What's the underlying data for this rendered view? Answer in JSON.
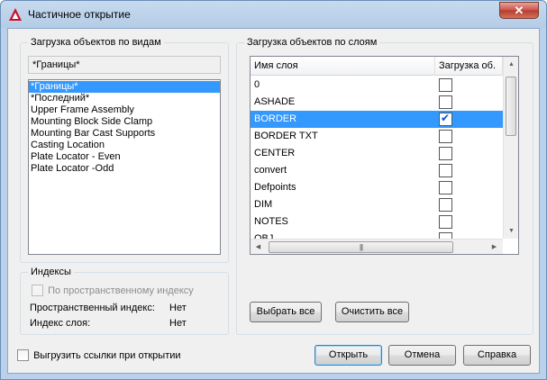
{
  "window": {
    "title": "Частичное открытие",
    "close_glyph": "✕"
  },
  "views_group": {
    "label": "Загрузка объектов по видам",
    "current_view": "*Границы*",
    "items": [
      {
        "label": "*Границы*",
        "selected": true
      },
      {
        "label": "*Последний*",
        "selected": false
      },
      {
        "label": "Upper Frame Assembly",
        "selected": false
      },
      {
        "label": "Mounting Block Side Clamp",
        "selected": false
      },
      {
        "label": "Mounting Bar Cast Supports",
        "selected": false
      },
      {
        "label": "Casting Location",
        "selected": false
      },
      {
        "label": "Plate Locator - Even",
        "selected": false
      },
      {
        "label": "Plate Locator -Odd",
        "selected": false
      }
    ]
  },
  "indexes_group": {
    "label": "Индексы",
    "spatial_checkbox_label": "По пространственному индексу",
    "spatial_checkbox_checked": false,
    "spatial_index_label": "Пространственный индекс:",
    "spatial_index_value": "Нет",
    "layer_index_label": "Индекс слоя:",
    "layer_index_value": "Нет"
  },
  "layers_group": {
    "label": "Загрузка объектов по слоям",
    "columns": {
      "name": "Имя слоя",
      "load": "Загрузка об."
    },
    "rows": [
      {
        "name": "0",
        "loaded": false,
        "selected": false
      },
      {
        "name": "ASHADE",
        "loaded": false,
        "selected": false
      },
      {
        "name": "BORDER",
        "loaded": true,
        "selected": true
      },
      {
        "name": "BORDER TXT",
        "loaded": false,
        "selected": false
      },
      {
        "name": "CENTER",
        "loaded": false,
        "selected": false
      },
      {
        "name": "convert",
        "loaded": false,
        "selected": false
      },
      {
        "name": "Defpoints",
        "loaded": false,
        "selected": false
      },
      {
        "name": "DIM",
        "loaded": false,
        "selected": false
      },
      {
        "name": "NOTES",
        "loaded": false,
        "selected": false
      },
      {
        "name": "OBJ",
        "loaded": false,
        "selected": false
      }
    ],
    "select_all_label": "Выбрать все",
    "clear_all_label": "Очистить все"
  },
  "footer": {
    "unload_refs_label": "Выгрузить ссылки при открытии",
    "unload_refs_checked": false,
    "open_label": "Открыть",
    "cancel_label": "Отмена",
    "help_label": "Справка"
  },
  "colors": {
    "selection": "#3399ff",
    "title_bar": "#b9d1ea",
    "close_button": "#c75050",
    "check_mark": "#0055cc",
    "app_icon": "#c8102e"
  }
}
